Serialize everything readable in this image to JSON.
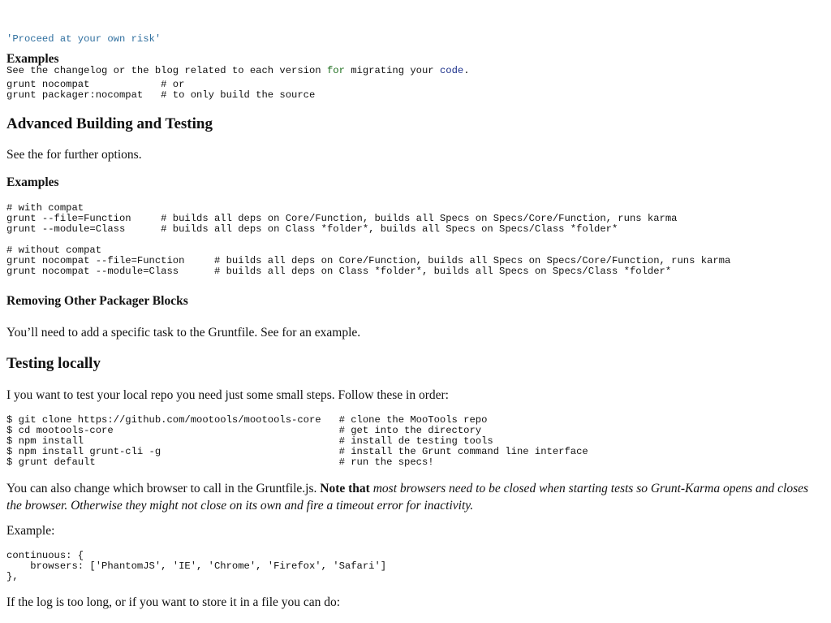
{
  "intro_code": {
    "line1_str": "'Proceed at your own risk'",
    "line2_pre": "See the changelog or the blog related to each version ",
    "line2_kw": "for",
    "line2_mid": " migrating your ",
    "line2_code": "code",
    "line2_end": "."
  },
  "examples1": {
    "heading": "Examples",
    "code": "grunt nocompat            # or\ngrunt packager:nocompat   # to only build the source"
  },
  "advanced": {
    "heading": "Advanced Building and Testing",
    "text": "See the for further options."
  },
  "examples2": {
    "heading": "Examples",
    "code_compat": "# with compat\ngrunt --file=Function     # builds all deps on Core/Function, builds all Specs on Specs/Core/Function, runs karma\ngrunt --module=Class      # builds all deps on Class *folder*, builds all Specs on Specs/Class *folder*",
    "code_nocompat": "# without compat\ngrunt nocompat --file=Function     # builds all deps on Core/Function, builds all Specs on Specs/Core/Function, runs karma\ngrunt nocompat --module=Class      # builds all deps on Class *folder*, builds all Specs on Specs/Class *folder*"
  },
  "removing": {
    "heading": "Removing Other Packager Blocks",
    "text": "You’ll need to add a specific task to the Gruntfile. See for an example."
  },
  "testing": {
    "heading": "Testing locally",
    "text": "I you want to test your local repo you need just some small steps. Follow these in order:",
    "code": "$ git clone https://github.com/mootools/mootools-core   # clone the MooTools repo\n$ cd mootools-core                                      # get into the directory\n$ npm install                                           # install de testing tools\n$ npm install grunt-cli -g                              # install the Grunt command line interface\n$ grunt default                                         # run the specs!",
    "browser_text_plain": "You can also change which browser to call in the Gruntfile.js. ",
    "browser_text_strong": "Note that",
    "browser_text_em": " most browsers need to be closed when starting tests so Grunt-Karma opens and closes the browser. Otherwise they might not close on its own and fire a timeout error for inactivity.",
    "example_label": "Example:",
    "example_code": "continuous: {\n    browsers: ['PhantomJS', 'IE', 'Chrome', 'Firefox', 'Safari']\n},",
    "log_text": "If the log is too long, or if you want to store it in a file you can do:"
  }
}
